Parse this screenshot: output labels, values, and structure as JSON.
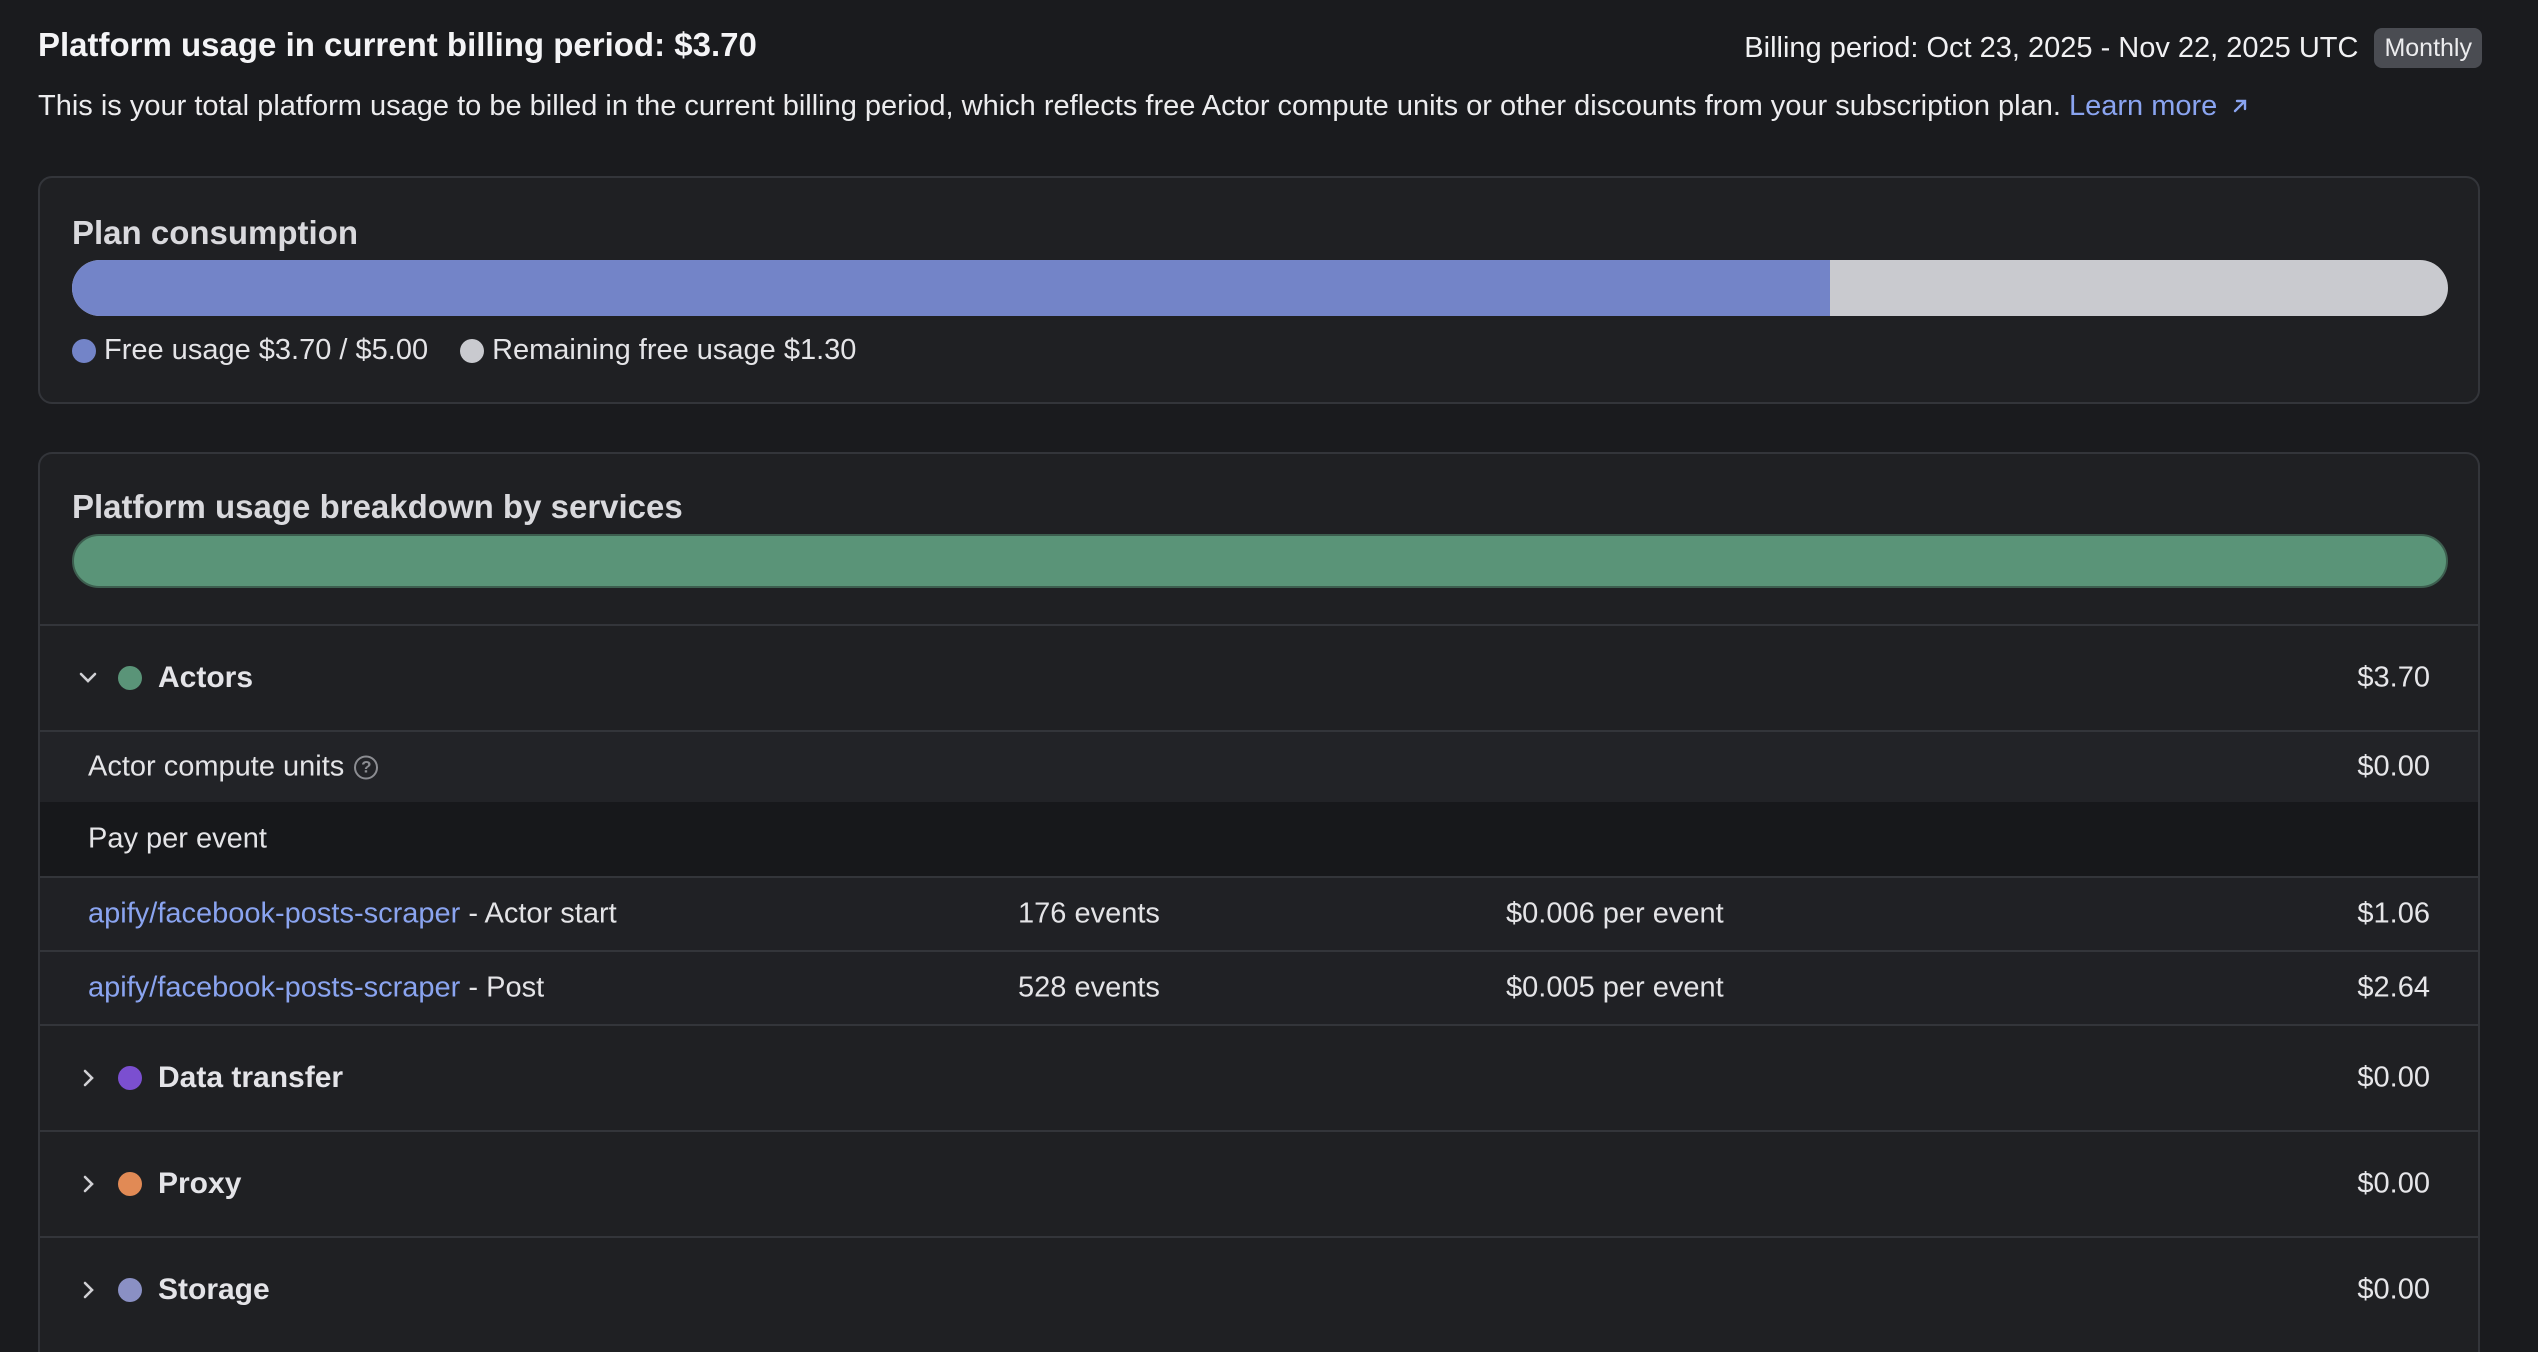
{
  "header": {
    "title": "Platform usage in current billing period: $3.70",
    "billing_period": "Billing period: Oct 23, 2025 - Nov 22, 2025 UTC",
    "badge": "Monthly",
    "description": "This is your total platform usage to be billed in the current billing period, which reflects free Actor compute units or other discounts from your subscription plan.",
    "learn_more": "Learn more",
    "learn_more_icon": "external-arrow-icon"
  },
  "plan": {
    "title": "Plan consumption",
    "used_fraction": 0.74,
    "used_color": "#7384c8",
    "remaining_color": "#c9cacf",
    "legend_used": "Free usage $3.70 / $5.00",
    "legend_remaining": "Remaining free usage $1.30"
  },
  "breakdown": {
    "title": "Platform usage breakdown by services",
    "bar_color": "#5a9478",
    "sections": [
      {
        "name": "Actors",
        "amount": "$3.70",
        "color": "#5a9478",
        "expanded": true
      },
      {
        "name": "Data transfer",
        "amount": "$0.00",
        "color": "#7b4fd0",
        "expanded": false
      },
      {
        "name": "Proxy",
        "amount": "$0.00",
        "color": "#e18a55",
        "expanded": false
      },
      {
        "name": "Storage",
        "amount": "$0.00",
        "color": "#8a90c4",
        "expanded": false
      }
    ],
    "actors": {
      "compute_units_label": "Actor compute units",
      "compute_units_amount": "$0.00",
      "pay_per_event_label": "Pay per event",
      "events": [
        {
          "actor": "apify/facebook-posts-scraper",
          "event": " - Actor start",
          "count": "176 events",
          "price": "$0.006 per event",
          "amount": "$1.06"
        },
        {
          "actor": "apify/facebook-posts-scraper",
          "event": " - Post",
          "count": "528 events",
          "price": "$0.005 per event",
          "amount": "$2.64"
        }
      ]
    }
  }
}
